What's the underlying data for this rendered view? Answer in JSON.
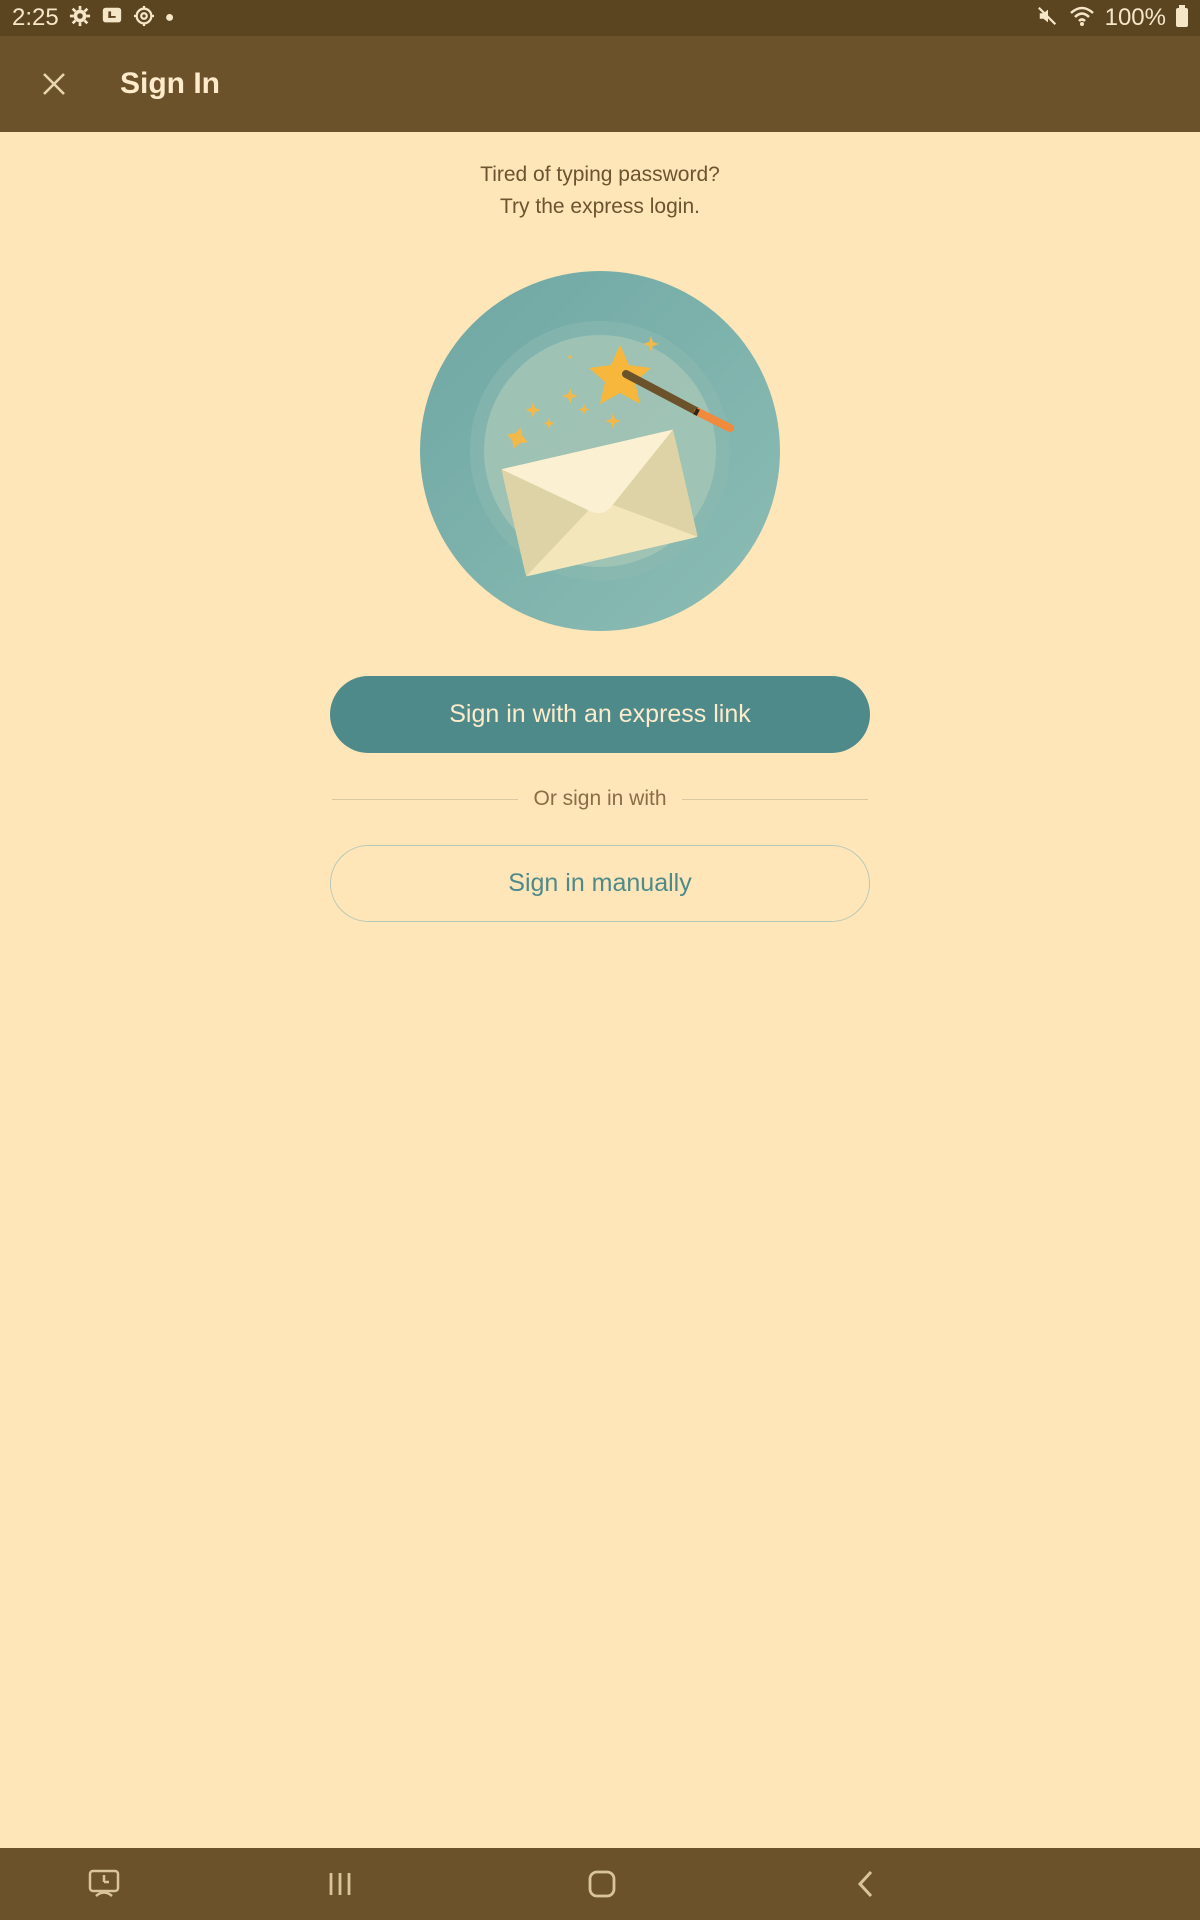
{
  "status_bar": {
    "time": "2:25",
    "battery": "100%",
    "left_icons": [
      "gear-icon",
      "screen-share-icon",
      "settings-cog-icon",
      "dot-icon"
    ],
    "right_icons": [
      "mute-icon",
      "wifi-icon",
      "battery-icon"
    ]
  },
  "app_bar": {
    "title": "Sign In",
    "close_icon": "close-icon"
  },
  "main": {
    "tagline_line1": "Tired of typing password?",
    "tagline_line2": "Try the express login.",
    "illustration": "envelope-magic-wand-illustration",
    "express_button_label": "Sign in with an express link",
    "divider_text": "Or sign in with",
    "manual_button_label": "Sign in manually"
  },
  "nav_bar": {
    "items": [
      "screen-recorder-icon",
      "recent-apps-icon",
      "home-icon",
      "back-icon"
    ]
  },
  "colors": {
    "background": "#FFE6B8",
    "app_bar": "#6B522A",
    "status_bar": "#5B4420",
    "accent": "#4E8A8A"
  }
}
